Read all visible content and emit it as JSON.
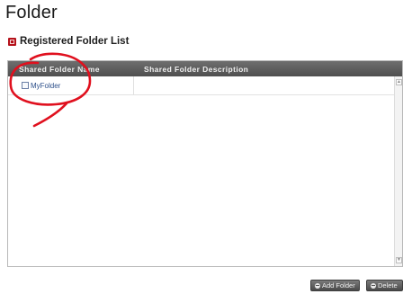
{
  "page": {
    "title": "Folder"
  },
  "section": {
    "title": "Registered Folder List",
    "icon": "section-marker-icon"
  },
  "table": {
    "columns": [
      "Shared Folder Name",
      "Shared Folder Description"
    ],
    "rows": [
      {
        "name": "MyFolder",
        "description": "",
        "checked": false
      }
    ]
  },
  "actions": {
    "add_label": "Add Folder",
    "delete_label": "Delete",
    "add_icon": "plus-icon",
    "delete_icon": "minus-icon"
  },
  "colors": {
    "header_bg": "#555555",
    "accent_red": "#b5121b",
    "annotation_red": "#e0101e",
    "link_blue": "#2c4f8a"
  }
}
